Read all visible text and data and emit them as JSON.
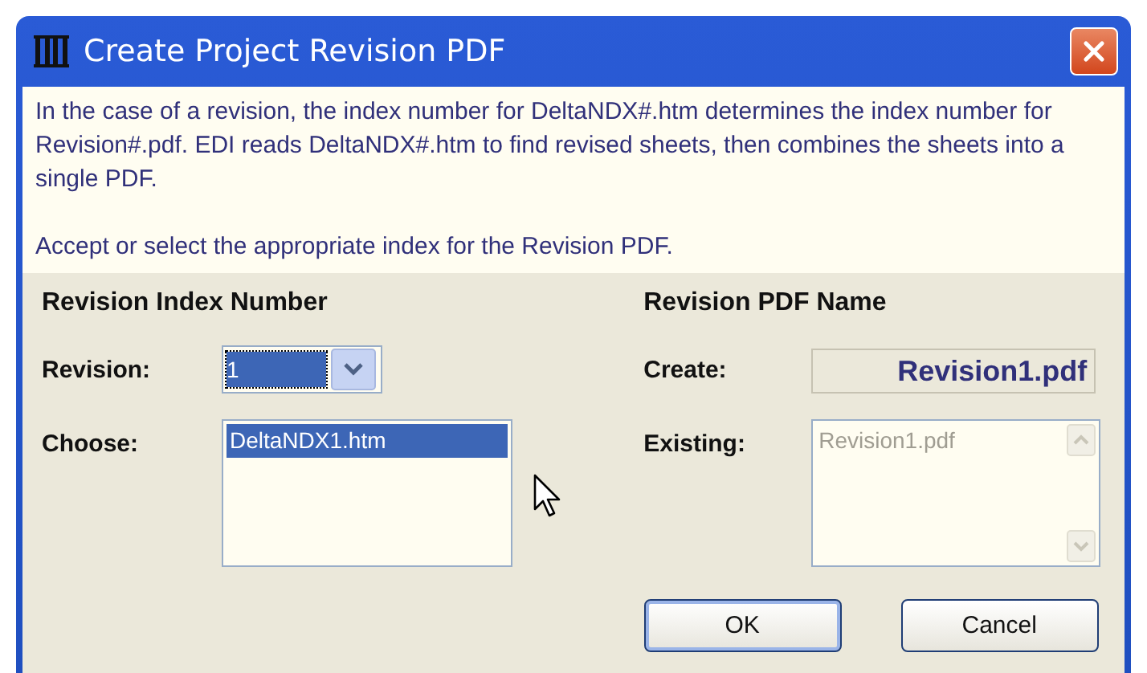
{
  "window": {
    "title": "Create Project Revision PDF"
  },
  "info": {
    "paragraphs": [
      "In the case of a revision, the index number for DeltaNDX#.htm determines the index number for Revision#.pdf.  EDI reads DeltaNDX#.htm to find revised sheets, then combines the sheets into a single PDF.",
      "Accept or select the appropriate index for the Revision PDF."
    ]
  },
  "index_section": {
    "heading": "Revision Index Number",
    "revision": {
      "label": "Revision:",
      "value": "1"
    },
    "choose": {
      "label": "Choose:",
      "items": [
        {
          "text": "DeltaNDX1.htm",
          "selected": true
        }
      ]
    }
  },
  "pdf_section": {
    "heading": "Revision PDF Name",
    "create": {
      "label": "Create:",
      "value": "Revision1.pdf"
    },
    "existing": {
      "label": "Existing:",
      "disabled": true,
      "items": [
        {
          "text": "Revision1.pdf",
          "selected": false
        }
      ]
    }
  },
  "buttons": [
    {
      "label": "OK",
      "default": true
    },
    {
      "label": "Cancel",
      "default": false
    }
  ]
}
